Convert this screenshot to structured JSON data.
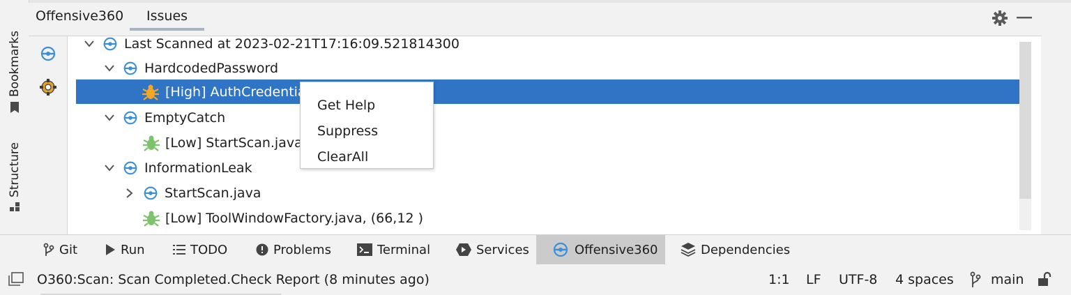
{
  "top_tabs": [
    {
      "label": "Offensive360"
    },
    {
      "label": "Issues"
    }
  ],
  "side_tabs": {
    "bookmarks": "Bookmarks",
    "structure": "Structure"
  },
  "tree": [
    {
      "label": "Last Scanned at 2023-02-21T17:16:09.521814300",
      "level": 0,
      "expanded": true,
      "icon": "offensive360-icon"
    },
    {
      "label": "HardcodedPassword",
      "level": 1,
      "expanded": true,
      "icon": "offensive360-icon"
    },
    {
      "label": "[High] AuthCredentia",
      "level": 2,
      "icon": "high-bug-icon",
      "selected": true
    },
    {
      "label": "EmptyCatch",
      "level": 1,
      "expanded": true,
      "icon": "offensive360-icon"
    },
    {
      "label": "[Low] StartScan.java, ",
      "level": 2,
      "icon": "low-bug-icon"
    },
    {
      "label": "InformationLeak",
      "level": 1,
      "expanded": true,
      "icon": "offensive360-icon"
    },
    {
      "label": "StartScan.java",
      "level": 2,
      "expanded": false,
      "icon": "offensive360-icon"
    },
    {
      "label": "[Low] ToolWindowFactory.java, (66,12 )",
      "level": 2,
      "icon": "low-bug-icon"
    }
  ],
  "context_menu": [
    "Get Help",
    "Suppress",
    "ClearAll"
  ],
  "bottom_tabs": [
    {
      "label": "Git",
      "icon": "git-branch-icon"
    },
    {
      "label": "Run",
      "icon": "run-icon"
    },
    {
      "label": "TODO",
      "icon": "todo-icon"
    },
    {
      "label": "Problems",
      "icon": "problems-icon"
    },
    {
      "label": "Terminal",
      "icon": "terminal-icon"
    },
    {
      "label": "Services",
      "icon": "services-icon"
    },
    {
      "label": "Offensive360",
      "icon": "offensive360-icon",
      "active": true
    },
    {
      "label": "Dependencies",
      "icon": "dependencies-icon"
    }
  ],
  "status": {
    "message": "O360:Scan: Scan Completed.Check Report (8 minutes ago)",
    "position": "1:1",
    "line_ending": "LF",
    "encoding": "UTF-8",
    "indent": "4 spaces",
    "branch": "main"
  },
  "colors": {
    "selection": "#2f74c5",
    "accent_blue": "#3a8fd6",
    "high_bug": "#f5a623",
    "low_bug": "#7cc36b"
  }
}
